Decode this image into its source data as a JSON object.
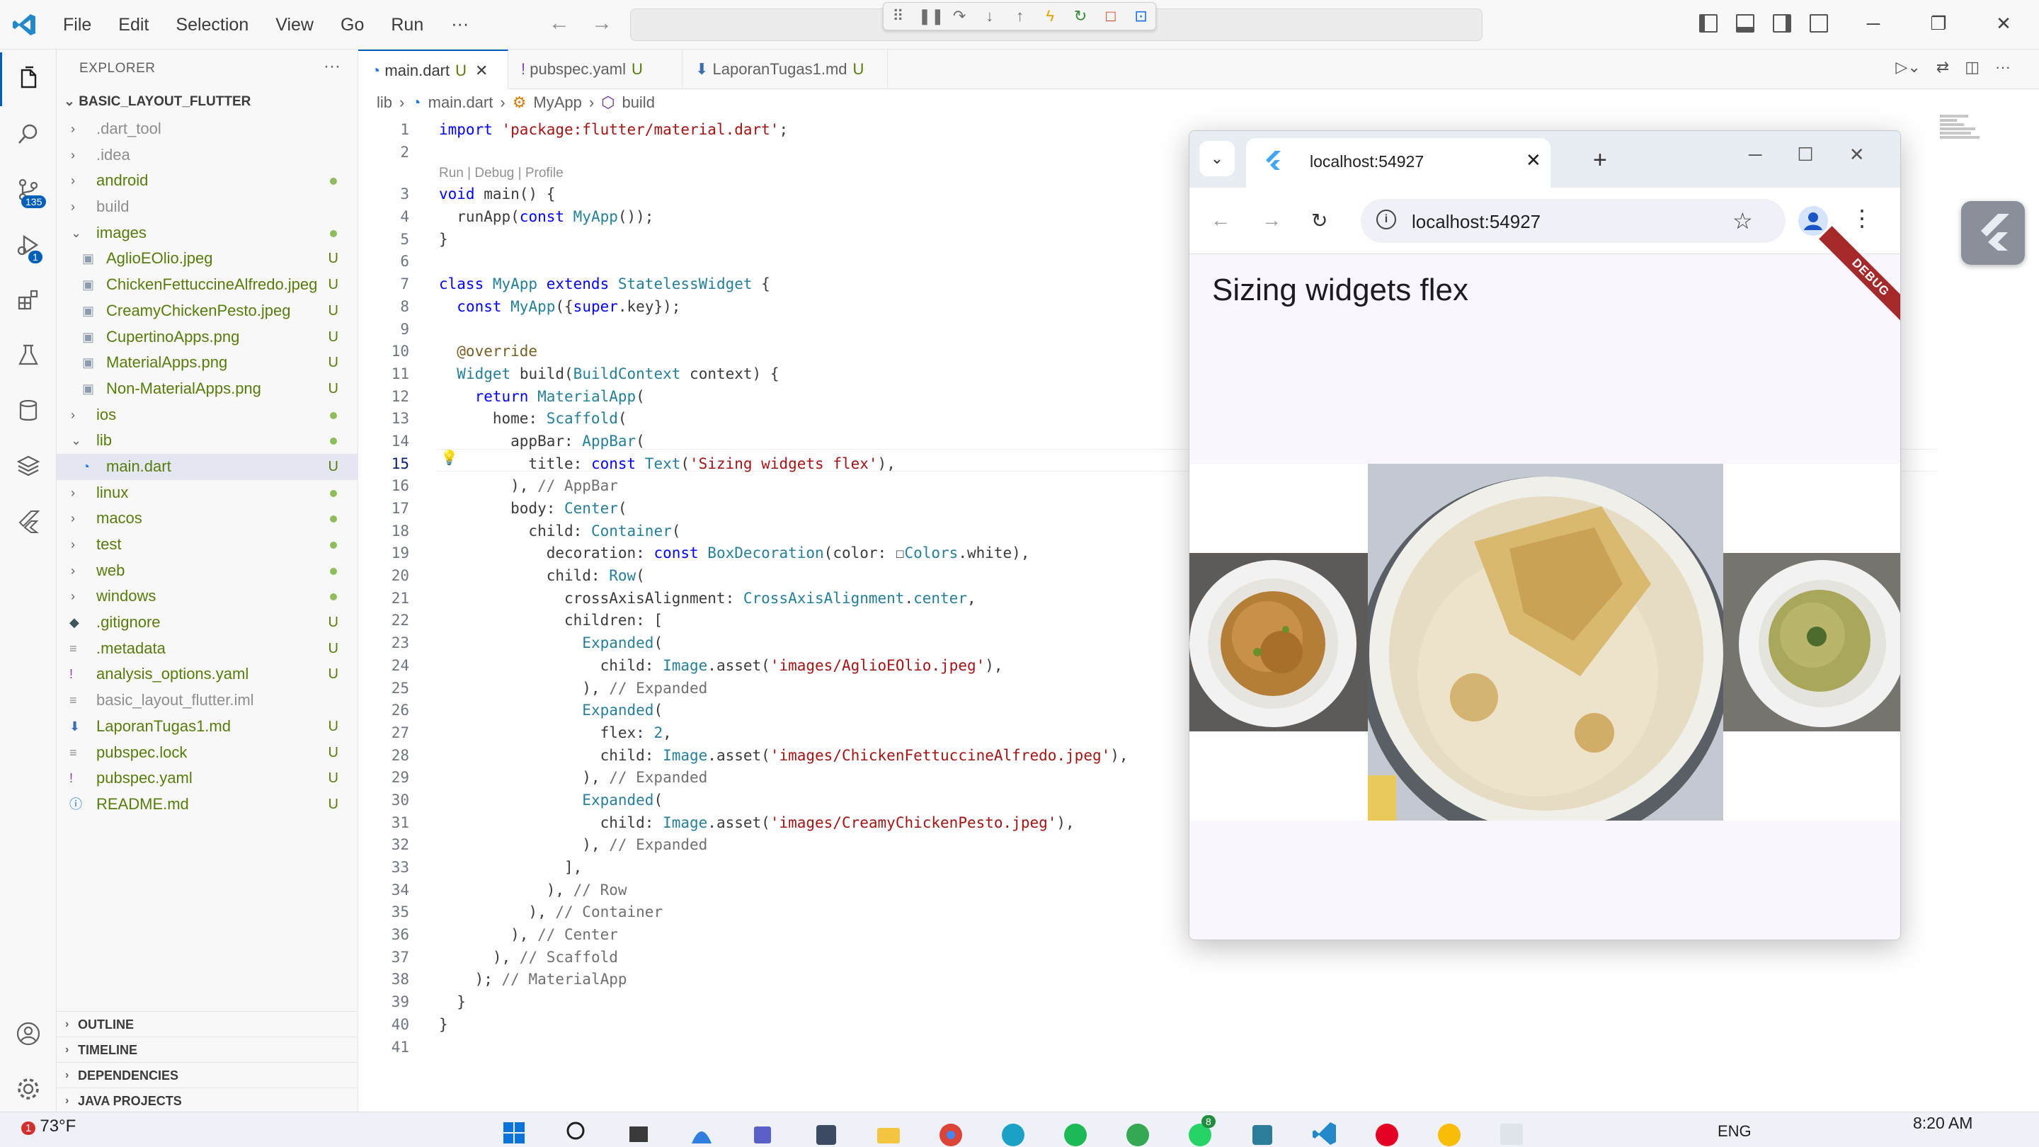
{
  "titlebar": {
    "menu": [
      "File",
      "Edit",
      "Selection",
      "View",
      "Go",
      "Run"
    ],
    "more": "···"
  },
  "activity": {
    "source_control_badge": "135",
    "debug_badge": "1"
  },
  "sidebar": {
    "title": "EXPLORER",
    "more": "···",
    "root": "BASIC_LAYOUT_FLUTTER",
    "items": [
      {
        "label": ".dart_tool",
        "type": "folder",
        "depth": 1,
        "expanded": false,
        "color": "gray",
        "status": ""
      },
      {
        "label": ".idea",
        "type": "folder",
        "depth": 1,
        "expanded": false,
        "color": "gray",
        "status": ""
      },
      {
        "label": "android",
        "type": "folder",
        "depth": 1,
        "expanded": false,
        "color": "green",
        "status": "dot"
      },
      {
        "label": "build",
        "type": "folder",
        "depth": 1,
        "expanded": false,
        "color": "gray",
        "status": ""
      },
      {
        "label": "images",
        "type": "folder",
        "depth": 1,
        "expanded": true,
        "color": "green",
        "status": "dot"
      },
      {
        "label": "AglioEOlio.jpeg",
        "type": "image",
        "depth": 2,
        "color": "green",
        "status": "U"
      },
      {
        "label": "ChickenFettuccineAlfredo.jpeg",
        "type": "image",
        "depth": 2,
        "color": "green",
        "status": "U"
      },
      {
        "label": "CreamyChickenPesto.jpeg",
        "type": "image",
        "depth": 2,
        "color": "green",
        "status": "U"
      },
      {
        "label": "CupertinoApps.png",
        "type": "image",
        "depth": 2,
        "color": "green",
        "status": "U"
      },
      {
        "label": "MaterialApps.png",
        "type": "image",
        "depth": 2,
        "color": "green",
        "status": "U"
      },
      {
        "label": "Non-MaterialApps.png",
        "type": "image",
        "depth": 2,
        "color": "green",
        "status": "U"
      },
      {
        "label": "ios",
        "type": "folder",
        "depth": 1,
        "expanded": false,
        "color": "green",
        "status": "dot"
      },
      {
        "label": "lib",
        "type": "folder",
        "depth": 1,
        "expanded": true,
        "color": "green",
        "status": "dot"
      },
      {
        "label": "main.dart",
        "type": "dart",
        "depth": 2,
        "color": "green",
        "status": "U",
        "selected": true
      },
      {
        "label": "linux",
        "type": "folder",
        "depth": 1,
        "expanded": false,
        "color": "green",
        "status": "dot"
      },
      {
        "label": "macos",
        "type": "folder",
        "depth": 1,
        "expanded": false,
        "color": "green",
        "status": "dot"
      },
      {
        "label": "test",
        "type": "folder",
        "depth": 1,
        "expanded": false,
        "color": "green",
        "status": "dot"
      },
      {
        "label": "web",
        "type": "folder",
        "depth": 1,
        "expanded": false,
        "color": "green",
        "status": "dot"
      },
      {
        "label": "windows",
        "type": "folder",
        "depth": 1,
        "expanded": false,
        "color": "green",
        "status": "dot"
      },
      {
        "label": ".gitignore",
        "type": "git",
        "depth": 1,
        "color": "green",
        "status": "U"
      },
      {
        "label": ".metadata",
        "type": "file",
        "depth": 1,
        "color": "green",
        "status": "U"
      },
      {
        "label": "analysis_options.yaml",
        "type": "yaml",
        "depth": 1,
        "color": "green",
        "status": "U"
      },
      {
        "label": "basic_layout_flutter.iml",
        "type": "file",
        "depth": 1,
        "color": "gray",
        "status": ""
      },
      {
        "label": "LaporanTugas1.md",
        "type": "md",
        "depth": 1,
        "color": "green",
        "status": "U"
      },
      {
        "label": "pubspec.lock",
        "type": "file",
        "depth": 1,
        "color": "green",
        "status": "U"
      },
      {
        "label": "pubspec.yaml",
        "type": "yaml",
        "depth": 1,
        "color": "green",
        "status": "U"
      },
      {
        "label": "README.md",
        "type": "info",
        "depth": 1,
        "color": "green",
        "status": "U"
      }
    ],
    "sections": [
      "OUTLINE",
      "TIMELINE",
      "DEPENDENCIES",
      "JAVA PROJECTS"
    ]
  },
  "tabs": [
    {
      "label": "main.dart",
      "status": "U",
      "active": true
    },
    {
      "label": "pubspec.yaml",
      "status": "U",
      "active": false
    },
    {
      "label": "LaporanTugas1.md",
      "status": "U",
      "active": false
    }
  ],
  "breadcrumb": [
    "lib",
    "main.dart",
    "MyApp",
    "build"
  ],
  "code": {
    "codelens": "Run | Debug | Profile",
    "current_line": 15,
    "lines": [
      [
        [
          "kw",
          "import "
        ],
        [
          "str",
          "'package:flutter/material.dart'"
        ],
        [
          "",
          "; "
        ]
      ],
      [],
      [
        [
          "kw",
          "void "
        ],
        [
          "",
          "main() {"
        ]
      ],
      [
        [
          "",
          "  runApp("
        ],
        [
          "kw",
          "const "
        ],
        [
          "cls",
          "MyApp"
        ],
        [
          "",
          "());"
        ]
      ],
      [
        [
          "",
          "}"
        ]
      ],
      [],
      [
        [
          "kw",
          "class "
        ],
        [
          "cls",
          "MyApp "
        ],
        [
          "kw",
          "extends "
        ],
        [
          "cls",
          "StatelessWidget "
        ],
        [
          "",
          "{"
        ]
      ],
      [
        [
          "",
          "  "
        ],
        [
          "kw",
          "const "
        ],
        [
          "cls",
          "MyApp"
        ],
        [
          "",
          "({"
        ],
        [
          "kw",
          "super"
        ],
        [
          "",
          ".key});"
        ]
      ],
      [],
      [
        [
          "ann",
          "  @override"
        ]
      ],
      [
        [
          "",
          "  "
        ],
        [
          "cls",
          "Widget "
        ],
        [
          "",
          "build("
        ],
        [
          "cls",
          "BuildContext "
        ],
        [
          "",
          "context) {"
        ]
      ],
      [
        [
          "",
          "    "
        ],
        [
          "kw",
          "return "
        ],
        [
          "cls",
          "MaterialApp"
        ],
        [
          "",
          "("
        ]
      ],
      [
        [
          "",
          "      home: "
        ],
        [
          "cls",
          "Scaffold"
        ],
        [
          "",
          "("
        ]
      ],
      [
        [
          "",
          "        appBar: "
        ],
        [
          "cls",
          "AppBar"
        ],
        [
          "",
          "("
        ]
      ],
      [
        [
          "",
          "          title: "
        ],
        [
          "kw",
          "const "
        ],
        [
          "cls",
          "Text"
        ],
        [
          "",
          "("
        ],
        [
          "str",
          "'Sizing widgets flex'"
        ],
        [
          "",
          "),"
        ]
      ],
      [
        [
          "",
          "        ), "
        ],
        [
          "cmt",
          "// AppBar"
        ]
      ],
      [
        [
          "",
          "        body: "
        ],
        [
          "cls",
          "Center"
        ],
        [
          "",
          "("
        ]
      ],
      [
        [
          "",
          "          child: "
        ],
        [
          "cls",
          "Container"
        ],
        [
          "",
          "("
        ]
      ],
      [
        [
          "",
          "            decoration: "
        ],
        [
          "kw",
          "const "
        ],
        [
          "cls",
          "BoxDecoration"
        ],
        [
          "",
          "(color: ☐"
        ],
        [
          "cls",
          "Colors"
        ],
        [
          "",
          ".white),"
        ]
      ],
      [
        [
          "",
          "            child: "
        ],
        [
          "cls",
          "Row"
        ],
        [
          "",
          "("
        ]
      ],
      [
        [
          "",
          "              crossAxisAlignment: "
        ],
        [
          "cls",
          "CrossAxisAlignment"
        ],
        [
          "",
          "."
        ],
        [
          "cls",
          "center"
        ],
        [
          "",
          ","
        ]
      ],
      [
        [
          "",
          "              children: ["
        ]
      ],
      [
        [
          "",
          "                "
        ],
        [
          "cls",
          "Expanded"
        ],
        [
          "",
          "("
        ]
      ],
      [
        [
          "",
          "                  child: "
        ],
        [
          "cls",
          "Image"
        ],
        [
          "",
          ".asset("
        ],
        [
          "str",
          "'images/AglioEOlio.jpeg'"
        ],
        [
          "",
          "),"
        ]
      ],
      [
        [
          "",
          "                ), "
        ],
        [
          "cmt",
          "// Expanded"
        ]
      ],
      [
        [
          "",
          "                "
        ],
        [
          "cls",
          "Expanded"
        ],
        [
          "",
          "("
        ]
      ],
      [
        [
          "",
          "                  flex: "
        ],
        [
          "cls",
          "2"
        ],
        [
          "",
          ","
        ]
      ],
      [
        [
          "",
          "                  child: "
        ],
        [
          "cls",
          "Image"
        ],
        [
          "",
          ".asset("
        ],
        [
          "str",
          "'images/ChickenFettuccineAlfredo.jpeg'"
        ],
        [
          "",
          "),"
        ]
      ],
      [
        [
          "",
          "                ), "
        ],
        [
          "cmt",
          "// Expanded"
        ]
      ],
      [
        [
          "",
          "                "
        ],
        [
          "cls",
          "Expanded"
        ],
        [
          "",
          "("
        ]
      ],
      [
        [
          "",
          "                  child: "
        ],
        [
          "cls",
          "Image"
        ],
        [
          "",
          ".asset("
        ],
        [
          "str",
          "'images/CreamyChickenPesto.jpeg'"
        ],
        [
          "",
          "),"
        ]
      ],
      [
        [
          "",
          "                ), "
        ],
        [
          "cmt",
          "// Expanded"
        ]
      ],
      [
        [
          "",
          "              ],"
        ]
      ],
      [
        [
          "",
          "            ), "
        ],
        [
          "cmt",
          "// Row"
        ]
      ],
      [
        [
          "",
          "          ), "
        ],
        [
          "cmt",
          "// Container"
        ]
      ],
      [
        [
          "",
          "        ), "
        ],
        [
          "cmt",
          "// Center"
        ]
      ],
      [
        [
          "",
          "      ), "
        ],
        [
          "cmt",
          "// Scaffold"
        ]
      ],
      [
        [
          "",
          "    ); "
        ],
        [
          "cmt",
          "// MaterialApp"
        ]
      ],
      [
        [
          "",
          "  }"
        ]
      ],
      [
        [
          "",
          "}"
        ]
      ],
      []
    ]
  },
  "browser": {
    "tab_title": "localhost:54927",
    "url": "localhost:54927",
    "new_tab": "+",
    "app": {
      "title": "Sizing widgets flex",
      "debug_banner": "DEBUG",
      "images": [
        "AglioEOlio.jpeg",
        "ChickenFettuccineAlfredo.jpeg",
        "CreamyChickenPesto.jpeg"
      ],
      "flex": [
        1,
        2,
        1
      ]
    }
  },
  "taskbar": {
    "weather": "73°F",
    "weather_badge": "1",
    "lang": "ENG",
    "time": "8:20 AM",
    "app_badge": "8"
  }
}
